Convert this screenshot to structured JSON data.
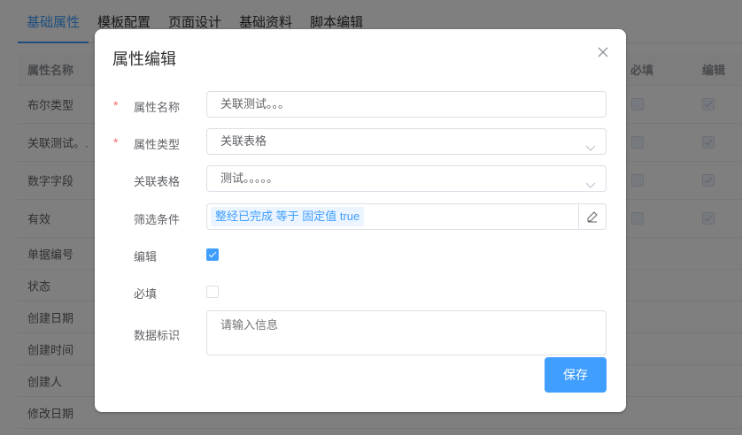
{
  "tabs": [
    {
      "label": "基础属性"
    },
    {
      "label": "模板配置"
    },
    {
      "label": "页面设计"
    },
    {
      "label": "基础资料"
    },
    {
      "label": "脚本编辑"
    }
  ],
  "table": {
    "headers": {
      "name": "属性名称",
      "required": "必填",
      "editable": "编辑"
    },
    "rows": [
      {
        "name": "布尔类型"
      },
      {
        "name": "关联测试。."
      },
      {
        "name": "数字字段"
      },
      {
        "name": "有效"
      },
      {
        "name": "单据编号"
      },
      {
        "name": "状态"
      },
      {
        "name": "创建日期"
      },
      {
        "name": "创建时间"
      },
      {
        "name": "创建人"
      },
      {
        "name": "修改日期"
      }
    ]
  },
  "dialog": {
    "title": "属性编辑",
    "fields": {
      "name": {
        "label": "属性名称",
        "value": "关联测试。。。",
        "required": true
      },
      "type": {
        "label": "属性类型",
        "value": "关联表格",
        "required": true
      },
      "related_table": {
        "label": "关联表格",
        "value": "测试。。。。。"
      },
      "filter": {
        "label": "筛选条件",
        "tag": "整经已完成 等于 固定值 true"
      },
      "editable": {
        "label": "编辑",
        "checked": true
      },
      "required": {
        "label": "必填",
        "checked": false
      },
      "data_id": {
        "label": "数据标识",
        "placeholder": "请输入信息"
      }
    },
    "required_mark": "*",
    "save_label": "保存"
  },
  "icons": {
    "close": "close-icon",
    "select_arrow": "chevron-down-icon",
    "edit": "pencil-icon"
  },
  "colors": {
    "primary": "#409eff",
    "required": "#f56c6c",
    "mask": "rgba(0,0,0,0.5)"
  }
}
